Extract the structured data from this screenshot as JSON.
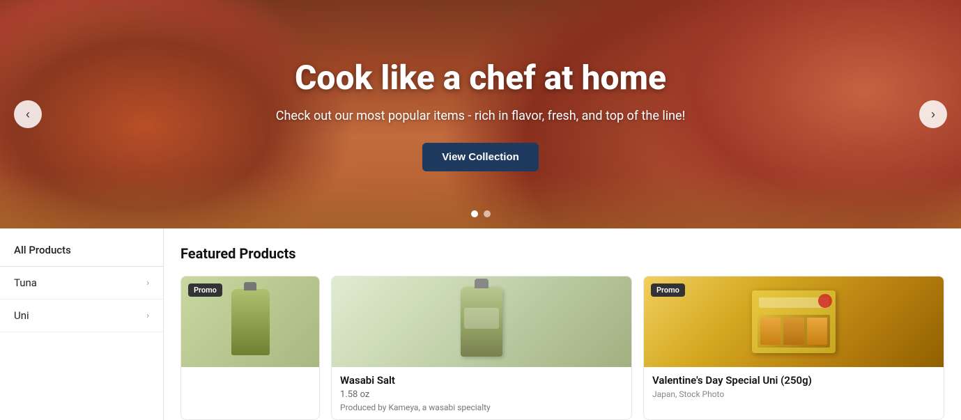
{
  "hero": {
    "title": "Cook like a chef at home",
    "subtitle": "Check out our most popular items - rich in flavor, fresh, and top of the line!",
    "cta_label": "View Collection",
    "prev_label": "‹",
    "next_label": "›",
    "dots": [
      {
        "active": true
      },
      {
        "active": false
      }
    ]
  },
  "sidebar": {
    "items": [
      {
        "label": "All Products",
        "has_chevron": false,
        "type": "all-products"
      },
      {
        "label": "Tuna",
        "has_chevron": true,
        "type": "category"
      },
      {
        "label": "Uni",
        "has_chevron": true,
        "type": "category"
      }
    ]
  },
  "products_section": {
    "title": "Featured Products",
    "products": [
      {
        "id": "partial-left",
        "promo": true,
        "promo_label": "Promo",
        "partial": true
      },
      {
        "id": "wasabi-salt",
        "name": "Wasabi Salt",
        "size": "1.58 oz",
        "description": "Produced by Kameya, a wasabi specialty",
        "promo": false,
        "partial": false
      },
      {
        "id": "uni-special",
        "name": "Valentine's Day Special Uni (250g)",
        "size": "",
        "description": "Japan, Stock Photo",
        "promo": true,
        "promo_label": "Promo",
        "partial": false
      }
    ]
  }
}
